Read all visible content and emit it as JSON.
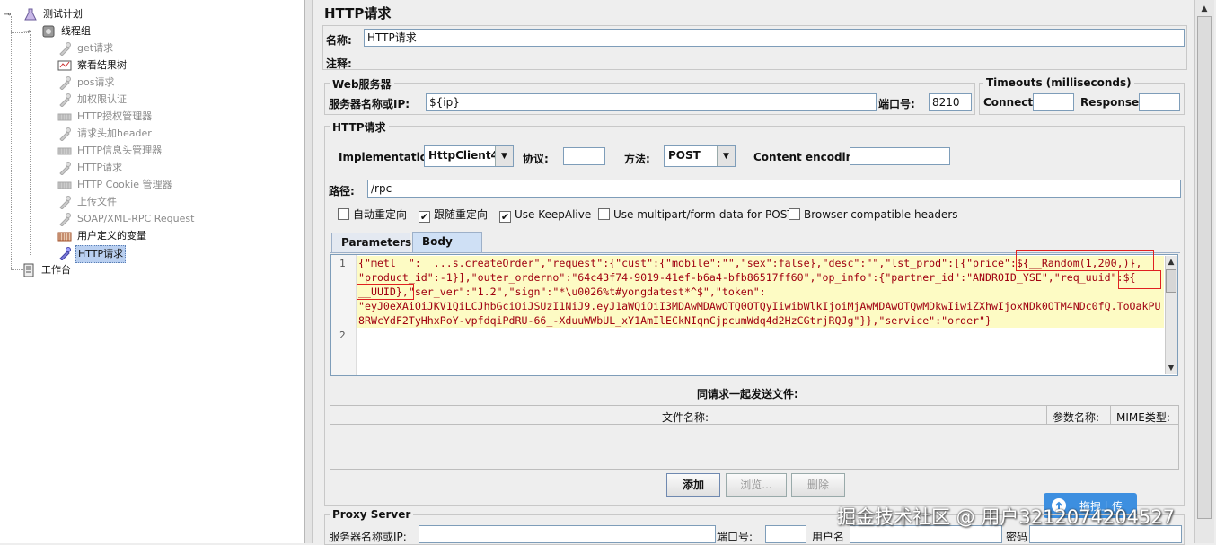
{
  "tree": {
    "items": [
      {
        "label": "测试计划",
        "icon": "flask-icon",
        "dim": false
      },
      {
        "label": "线程组",
        "icon": "gear-icon",
        "dim": false
      },
      {
        "label": "get请求",
        "icon": "pipette-icon",
        "dim": true
      },
      {
        "label": "察看结果树",
        "icon": "chart-icon",
        "dim": false
      },
      {
        "label": "pos请求",
        "icon": "pipette-icon",
        "dim": true
      },
      {
        "label": "加权限认证",
        "icon": "pipette-icon",
        "dim": true
      },
      {
        "label": "HTTP授权管理器",
        "icon": "wrench-icon",
        "dim": true
      },
      {
        "label": "请求头加header",
        "icon": "pipette-icon",
        "dim": true
      },
      {
        "label": "HTTP信息头管理器",
        "icon": "wrench-icon",
        "dim": true
      },
      {
        "label": "HTTP请求",
        "icon": "pipette-icon",
        "dim": true
      },
      {
        "label": "HTTP Cookie 管理器",
        "icon": "wrench-icon",
        "dim": true
      },
      {
        "label": "上传文件",
        "icon": "pipette-icon",
        "dim": true
      },
      {
        "label": "SOAP/XML-RPC Request",
        "icon": "pipette-icon",
        "dim": true
      },
      {
        "label": "用户定义的变量",
        "icon": "variables-icon",
        "dim": false
      },
      {
        "label": "HTTP请求",
        "icon": "pipette-icon",
        "dim": false,
        "selected": true
      },
      {
        "label": "工作台",
        "icon": "workbench-icon",
        "dim": false
      }
    ]
  },
  "panel": {
    "title": "HTTP请求",
    "name_label": "名称:",
    "name_value": "HTTP请求",
    "comment_label": "注释:",
    "web_server": {
      "legend": "Web服务器",
      "server_label": "服务器名称或IP:",
      "server_value": "${ip}",
      "port_label": "端口号:",
      "port_value": "8210"
    },
    "timeouts": {
      "legend": "Timeouts (milliseconds)",
      "connect_label": "Connect:",
      "response_label": "Response:"
    },
    "http_request": {
      "legend": "HTTP请求",
      "impl_label": "Implementation:",
      "impl_value": "HttpClient4",
      "protocol_label": "协议:",
      "method_label": "方法:",
      "method_value": "POST",
      "encoding_label": "Content encoding:",
      "path_label": "路径:",
      "path_value": "/rpc"
    },
    "checkboxes": [
      {
        "label": "自动重定向",
        "checked": false
      },
      {
        "label": "跟随重定向",
        "checked": true
      },
      {
        "label": "Use KeepAlive",
        "checked": true
      },
      {
        "label": "Use multipart/form-data for POST",
        "checked": false
      },
      {
        "label": "Browser-compatible headers",
        "checked": false
      }
    ],
    "tabs": [
      {
        "label": "Parameters",
        "active": false
      },
      {
        "label": "Body Data",
        "active": true
      }
    ],
    "body": {
      "line_numbers": [
        "1",
        "2"
      ],
      "lines": [
        "{\"metl  \":  ...s.createOrder\",\"request\":{\"cust\":{\"mobile\":\"\",\"sex\":false},\"desc\":\"\",\"lst_prod\":[{\"price\":${__Random(1,200,)},",
        "\"product_id\":-1}],\"outer_orderno\":\"64c43f74-9019-41ef-b6a4-bfb86517ff60\",\"op_info\":{\"partner_id\":\"ANDROID_YSE\",\"req_uuid\":${",
        "__UUID},\"ser_ver\":\"1.2\",\"sign\":\"*\\u0026%t#yongdatest*^$\",\"token\":",
        "\"eyJ0eXAiOiJKV1QiLCJhbGciOiJSUzI1NiJ9.eyJ1aWQiOiI3MDAwMDAwOTQ0OTQyIiwibWlkIjoiMjAwMDAwOTQwMDkwIiwiZXhwIjoxNDk0OTM4NDc0fQ.ToOakPU",
        "8RWcYdF2TyHhxPoY-vpfdqiPdRU-66_-XduuWWbUL_xY1AmIlECkNIqnCjpcumWdq4d2HzCGtrjRQJg\"}},\"service\":\"order\"}"
      ]
    },
    "files": {
      "heading": "同请求一起发送文件:",
      "col_filename": "文件名称:",
      "col_param": "参数名称:",
      "col_mime": "MIME类型:"
    },
    "buttons": {
      "add": "添加",
      "browse": "浏览...",
      "delete": "删除"
    },
    "proxy": {
      "legend": "Proxy Server",
      "server_label": "服务器名称或IP:",
      "port_label": "端口号:",
      "user_label": "用户名",
      "password_label": "密码"
    },
    "upload_badge": "拖拽上传",
    "watermark": "掘金技术社区 @ 用户3212074204527"
  }
}
